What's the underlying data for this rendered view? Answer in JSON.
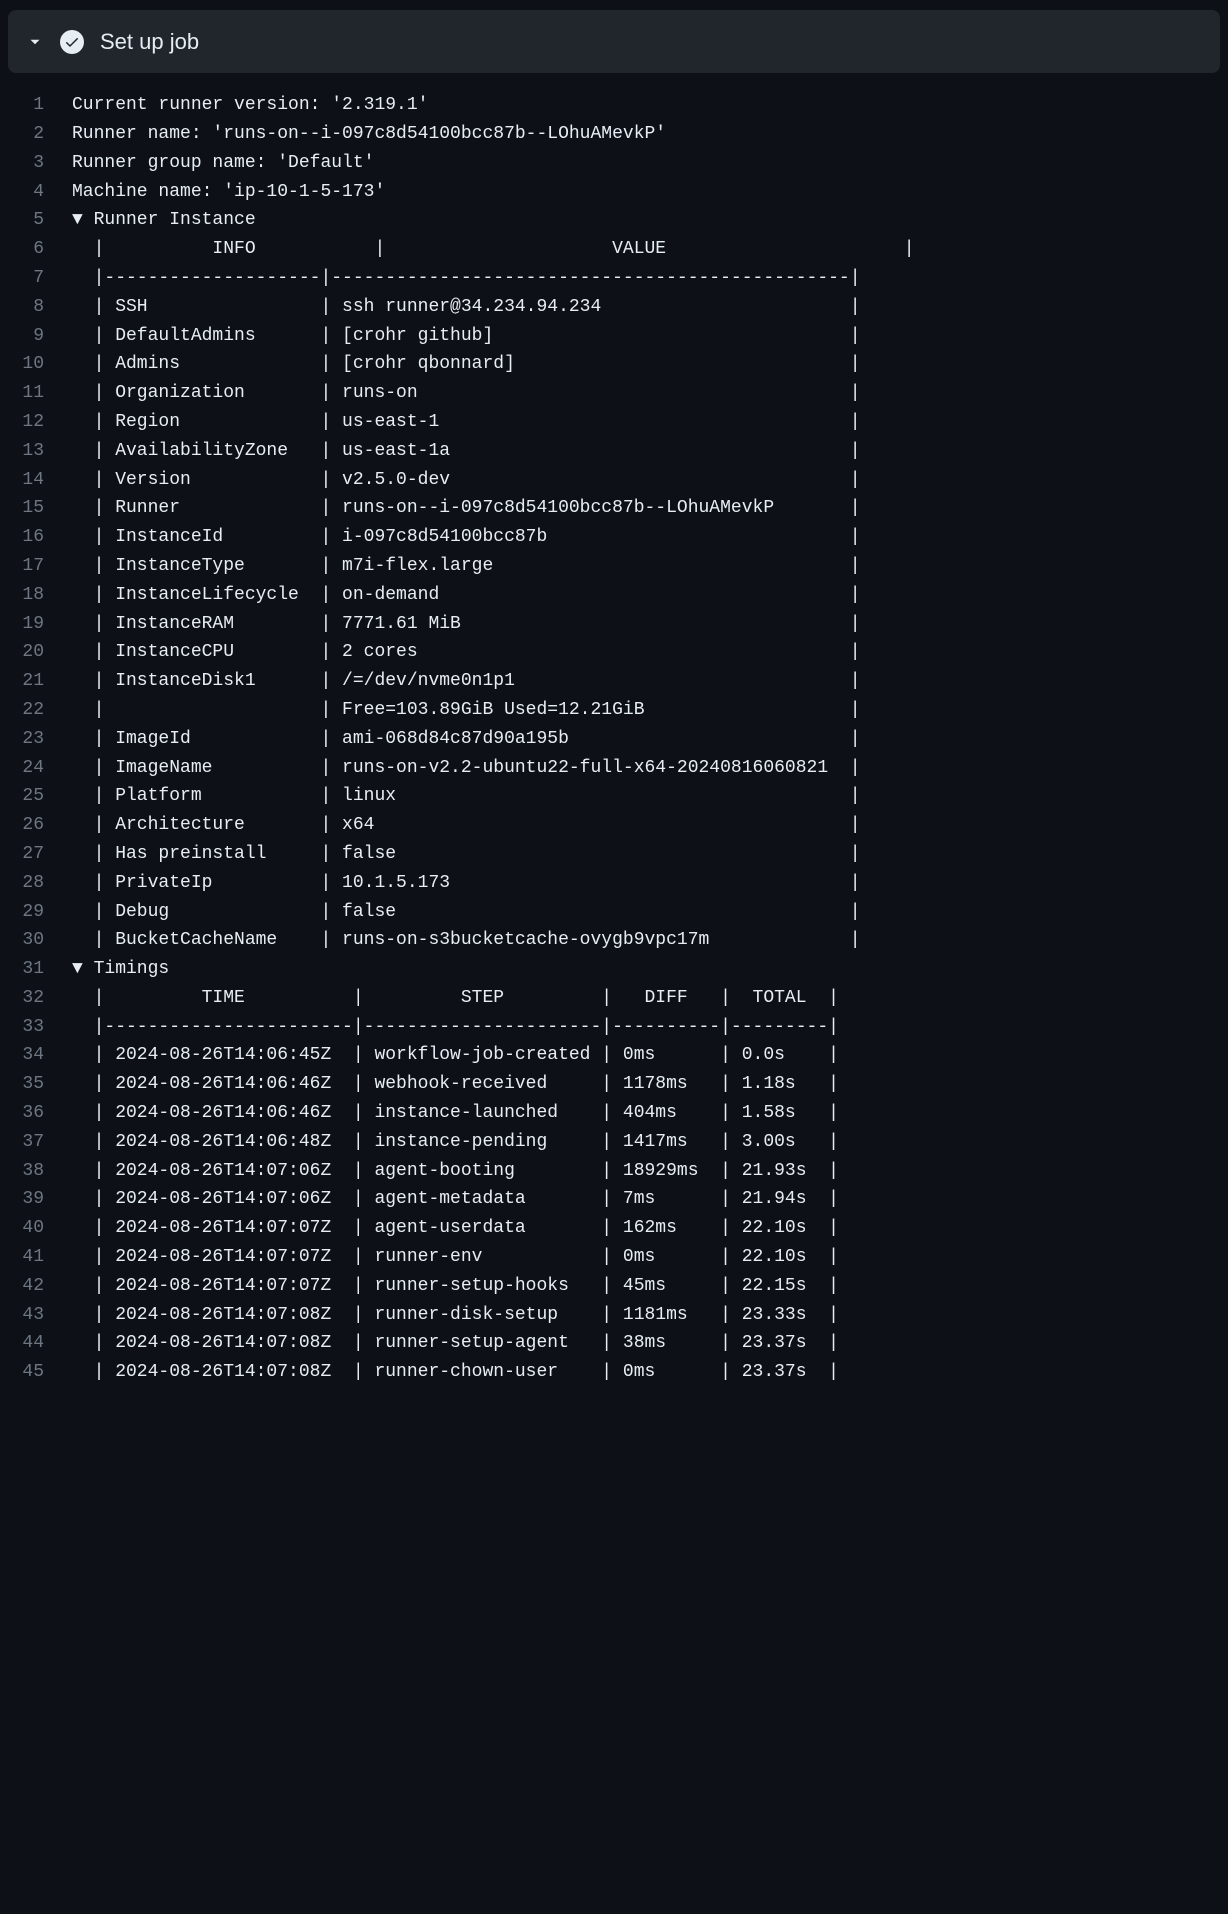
{
  "header": {
    "title": "Set up job"
  },
  "table_headers": {
    "info": "INFO",
    "value": "VALUE",
    "time": "TIME",
    "step": "STEP",
    "diff": "DIFF",
    "total": "TOTAL"
  },
  "log": {
    "intro": [
      "Current runner version: '2.319.1'",
      "Runner name: 'runs-on--i-097c8d54100bcc87b--LOhuAMevkP'",
      "Runner group name: 'Default'",
      "Machine name: 'ip-10-1-5-173'"
    ],
    "section1": "Runner Instance",
    "section2": "Timings",
    "info_rows": [
      [
        "SSH",
        "ssh runner@34.234.94.234"
      ],
      [
        "DefaultAdmins",
        "[crohr github]"
      ],
      [
        "Admins",
        "[crohr qbonnard]"
      ],
      [
        "Organization",
        "runs-on"
      ],
      [
        "Region",
        "us-east-1"
      ],
      [
        "AvailabilityZone",
        "us-east-1a"
      ],
      [
        "Version",
        "v2.5.0-dev"
      ],
      [
        "Runner",
        "runs-on--i-097c8d54100bcc87b--LOhuAMevkP"
      ],
      [
        "InstanceId",
        "i-097c8d54100bcc87b"
      ],
      [
        "InstanceType",
        "m7i-flex.large"
      ],
      [
        "InstanceLifecycle",
        "on-demand"
      ],
      [
        "InstanceRAM",
        "7771.61 MiB"
      ],
      [
        "InstanceCPU",
        "2 cores"
      ],
      [
        "InstanceDisk1",
        "/=/dev/nvme0n1p1"
      ],
      [
        "",
        "Free=103.89GiB Used=12.21GiB"
      ],
      [
        "ImageId",
        "ami-068d84c87d90a195b"
      ],
      [
        "ImageName",
        "runs-on-v2.2-ubuntu22-full-x64-20240816060821"
      ],
      [
        "Platform",
        "linux"
      ],
      [
        "Architecture",
        "x64"
      ],
      [
        "Has preinstall",
        "false"
      ],
      [
        "PrivateIp",
        "10.1.5.173"
      ],
      [
        "Debug",
        "false"
      ],
      [
        "BucketCacheName",
        "runs-on-s3bucketcache-ovygb9vpc17m"
      ]
    ],
    "timing_rows": [
      [
        "2024-08-26T14:06:45Z",
        "workflow-job-created",
        "0ms",
        "0.0s"
      ],
      [
        "2024-08-26T14:06:46Z",
        "webhook-received",
        "1178ms",
        "1.18s"
      ],
      [
        "2024-08-26T14:06:46Z",
        "instance-launched",
        "404ms",
        "1.58s"
      ],
      [
        "2024-08-26T14:06:48Z",
        "instance-pending",
        "1417ms",
        "3.00s"
      ],
      [
        "2024-08-26T14:07:06Z",
        "agent-booting",
        "18929ms",
        "21.93s"
      ],
      [
        "2024-08-26T14:07:06Z",
        "agent-metadata",
        "7ms",
        "21.94s"
      ],
      [
        "2024-08-26T14:07:07Z",
        "agent-userdata",
        "162ms",
        "22.10s"
      ],
      [
        "2024-08-26T14:07:07Z",
        "runner-env",
        "0ms",
        "22.10s"
      ],
      [
        "2024-08-26T14:07:07Z",
        "runner-setup-hooks",
        "45ms",
        "22.15s"
      ],
      [
        "2024-08-26T14:07:08Z",
        "runner-disk-setup",
        "1181ms",
        "23.33s"
      ],
      [
        "2024-08-26T14:07:08Z",
        "runner-setup-agent",
        "38ms",
        "23.37s"
      ],
      [
        "2024-08-26T14:07:08Z",
        "runner-chown-user",
        "0ms",
        "23.37s"
      ]
    ]
  }
}
